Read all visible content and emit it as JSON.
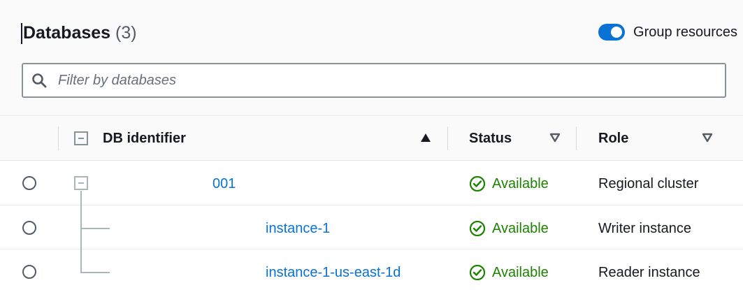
{
  "header": {
    "title": "Databases",
    "count": "(3)",
    "group_toggle_label": "Group resources"
  },
  "search": {
    "placeholder": "Filter by databases",
    "value": ""
  },
  "table": {
    "columns": [
      "DB identifier",
      "Status",
      "Role"
    ],
    "sort": {
      "column": "DB identifier",
      "direction": "ascending"
    },
    "rows": [
      {
        "id": "001",
        "status": "Available",
        "role": "Regional cluster"
      },
      {
        "id": "instance-1",
        "status": "Available",
        "role": "Writer instance"
      },
      {
        "id": "instance-1-us-east-1d",
        "status": "Available",
        "role": "Reader instance"
      }
    ]
  },
  "colors": {
    "accent": "#0972d3",
    "available": "#1d8102",
    "text": "#16191f",
    "muted": "#545b64"
  },
  "icons": {
    "search": "search-icon",
    "sort_asc": "sort-ascending-icon",
    "sort": "sort-icon",
    "collapse": "collapse-icon",
    "status_ok": "check-circle-icon"
  }
}
